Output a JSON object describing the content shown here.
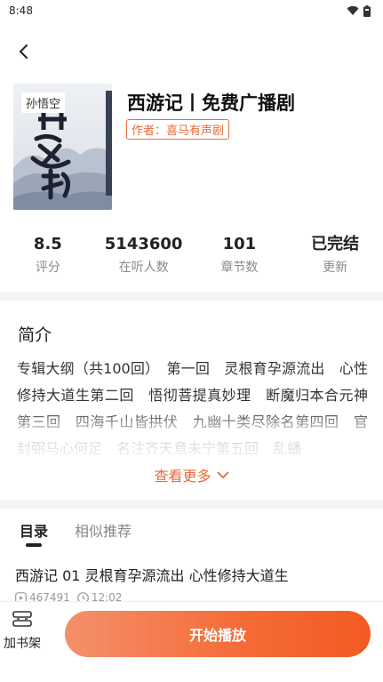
{
  "status_bar": {
    "time": "8:48",
    "wifi_icon": "wifi-icon",
    "battery_icon": "battery-icon"
  },
  "nav": {
    "back_icon": "chevron-left-icon"
  },
  "album": {
    "cover_tag": "孙悟空",
    "title": "西游记丨免费广播剧",
    "author": "作者：喜马有声剧"
  },
  "stats": [
    {
      "value": "8.5",
      "label": "评分"
    },
    {
      "value": "5143600",
      "label": "在听人数"
    },
    {
      "value": "101",
      "label": "章节数"
    },
    {
      "value": "已完结",
      "label": "更新"
    }
  ],
  "intro": {
    "heading": "简介",
    "text": "专辑大纲（共100回）　第一回　灵根育孕源流出　心性修持大道生第二回　悟彻菩提真妙理　断魔归本合元神第三回　四海千山皆拱伏　九幽十类尽除名第四回　官封弼马心何足　名注齐天意未宁第五回　乱蟠",
    "see_more": "查看更多"
  },
  "tabs": [
    {
      "label": "目录",
      "active": true
    },
    {
      "label": "相似推荐",
      "active": false
    }
  ],
  "episodes": [
    {
      "title": "西游记 01 灵根育孕源流出 心性修持大道生",
      "plays": "467491",
      "duration": "12:02"
    }
  ],
  "bottom": {
    "shelf_label": "加书架",
    "play_label": "开始播放"
  },
  "colors": {
    "accent": "#ec6a37",
    "play_gradient_start": "#f4906a",
    "play_gradient_end": "#f35a22"
  }
}
